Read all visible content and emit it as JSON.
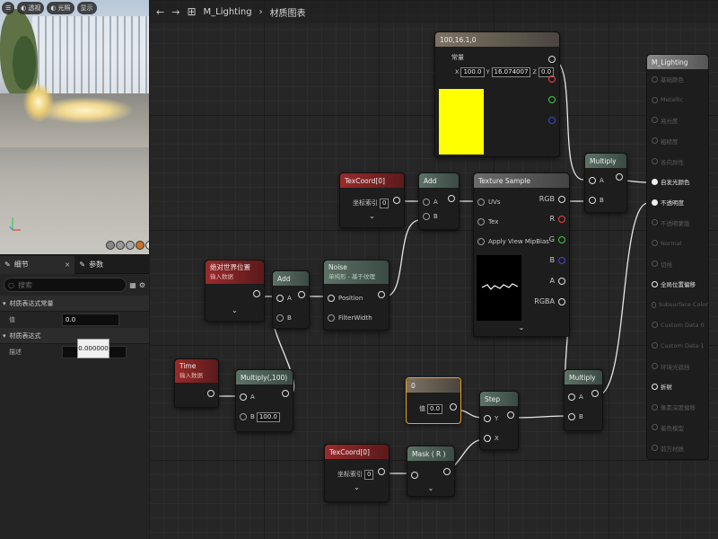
{
  "viewport": {
    "toolbar": [
      "透视",
      "光照",
      "显示"
    ]
  },
  "details": {
    "tabs": [
      {
        "label": "细节"
      },
      {
        "label": "参数"
      }
    ],
    "search_placeholder": "搜索",
    "section1": "材质表达式常量",
    "value_label": "值",
    "value": "0.0",
    "section2": "材质表达式",
    "desc_label": "描述",
    "tooltip": "0.000000"
  },
  "topbar": {
    "title": "M_Lighting",
    "crumb": "材质图表"
  },
  "nodes": {
    "const3": {
      "title": "100,16.1,0",
      "label": "常量",
      "x": "100.0",
      "y": "16.074007",
      "z": "0.0",
      "swatch": "#ffff00"
    },
    "texcoord1": {
      "title": "TexCoord[0]",
      "label": "坐标索引",
      "value": "0"
    },
    "add1": {
      "title": "Add",
      "a": "A",
      "b": "B"
    },
    "texsample": {
      "title": "Texture Sample",
      "uvs": "UVs",
      "tex": "Tex",
      "mip": "Apply View MipBias",
      "out": [
        "RGB",
        "R",
        "G",
        "B",
        "A",
        "RGBA"
      ]
    },
    "multiply_top": {
      "title": "Multiply",
      "a": "A",
      "b": "B"
    },
    "worldpos": {
      "title": "绝对世界位置",
      "sub": "输入数据"
    },
    "add2": {
      "title": "Add",
      "a": "A",
      "b": "B"
    },
    "noise": {
      "title": "Noise",
      "sub": "单纯形 - 基于纹理",
      "pos": "Position",
      "fw": "FilterWidth"
    },
    "time": {
      "title": "Time",
      "sub": "输入数据"
    },
    "multiply100": {
      "title": "Multiply(,100)",
      "a": "A",
      "b": "B",
      "bval": "100.0"
    },
    "const0": {
      "title": "0",
      "label": "值",
      "value": "0.0"
    },
    "step": {
      "title": "Step",
      "y": "Y",
      "x": "X"
    },
    "multiply_bot": {
      "title": "Multiply",
      "a": "A",
      "b": "B"
    },
    "texcoord2": {
      "title": "TexCoord[0]",
      "label": "坐标索引",
      "value": "0"
    },
    "mask": {
      "title": "Mask ( R )"
    }
  },
  "result": {
    "title": "M_Lighting",
    "pins": [
      {
        "label": "基础颜色",
        "on": false
      },
      {
        "label": "Metallic",
        "on": false
      },
      {
        "label": "高光度",
        "on": false
      },
      {
        "label": "粗糙度",
        "on": false
      },
      {
        "label": "各向异性",
        "on": false
      },
      {
        "label": "自发光颜色",
        "on": true
      },
      {
        "label": "不透明度",
        "on": true
      },
      {
        "label": "不透明蒙版",
        "on": false
      },
      {
        "label": "Normal",
        "on": false
      },
      {
        "label": "切线",
        "on": false
      },
      {
        "label": "全局位置偏移",
        "on": true
      },
      {
        "label": "Subsurface Color",
        "on": false
      },
      {
        "label": "Custom Data 0",
        "on": false
      },
      {
        "label": "Custom Data 1",
        "on": false
      },
      {
        "label": "环境光遮挡",
        "on": false
      },
      {
        "label": "折射",
        "on": true
      },
      {
        "label": "像素深度偏移",
        "on": false
      },
      {
        "label": "着色模型",
        "on": false
      },
      {
        "label": "前方材质",
        "on": false
      }
    ]
  },
  "colors": {
    "accent_swatch": "#ffff00",
    "graph_bg": "#262626"
  }
}
